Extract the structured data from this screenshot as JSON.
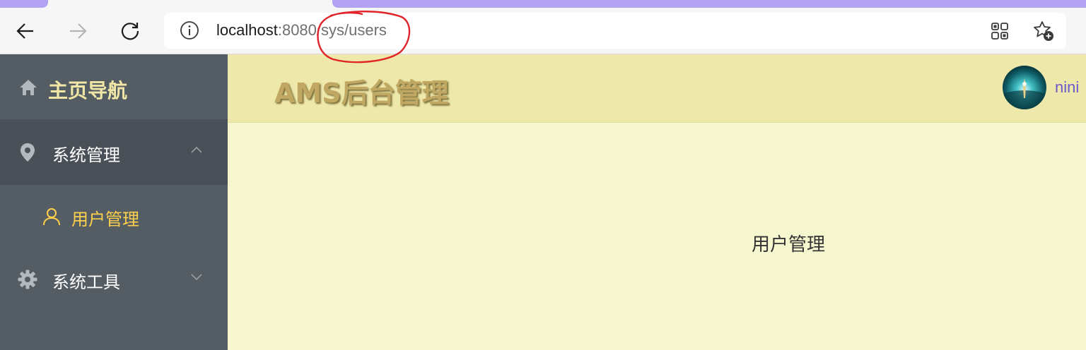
{
  "browser": {
    "url_host": "localhost",
    "url_rest": ":8080/sys/users",
    "icons": {
      "back": "arrow-left-icon",
      "forward": "arrow-right-icon",
      "reload": "reload-icon",
      "info": "info-icon",
      "apps": "apps-icon",
      "favorite": "star-add-icon"
    },
    "colors": {
      "tab_accent": "#b2a2f2",
      "annotation": "#e0242a"
    }
  },
  "sidebar": {
    "home_label": "主页导航",
    "items": [
      {
        "label": "系统管理",
        "icon": "location-icon",
        "expanded": true,
        "children": [
          {
            "label": "用户管理",
            "icon": "user-icon",
            "active": true
          }
        ]
      },
      {
        "label": "系统工具",
        "icon": "gear-icon",
        "expanded": false
      }
    ],
    "colors": {
      "bg": "#545c64",
      "active_text": "#ffd04b",
      "home_text": "#f0e6a6"
    }
  },
  "header": {
    "brand": "AMS后台管理",
    "username": "nini",
    "avatar_icon": "avatar-image",
    "colors": {
      "bg": "#eee8aa",
      "username": "#6a5acd"
    }
  },
  "main": {
    "text": "用户管理",
    "colors": {
      "bg": "#f7f7cf"
    }
  }
}
